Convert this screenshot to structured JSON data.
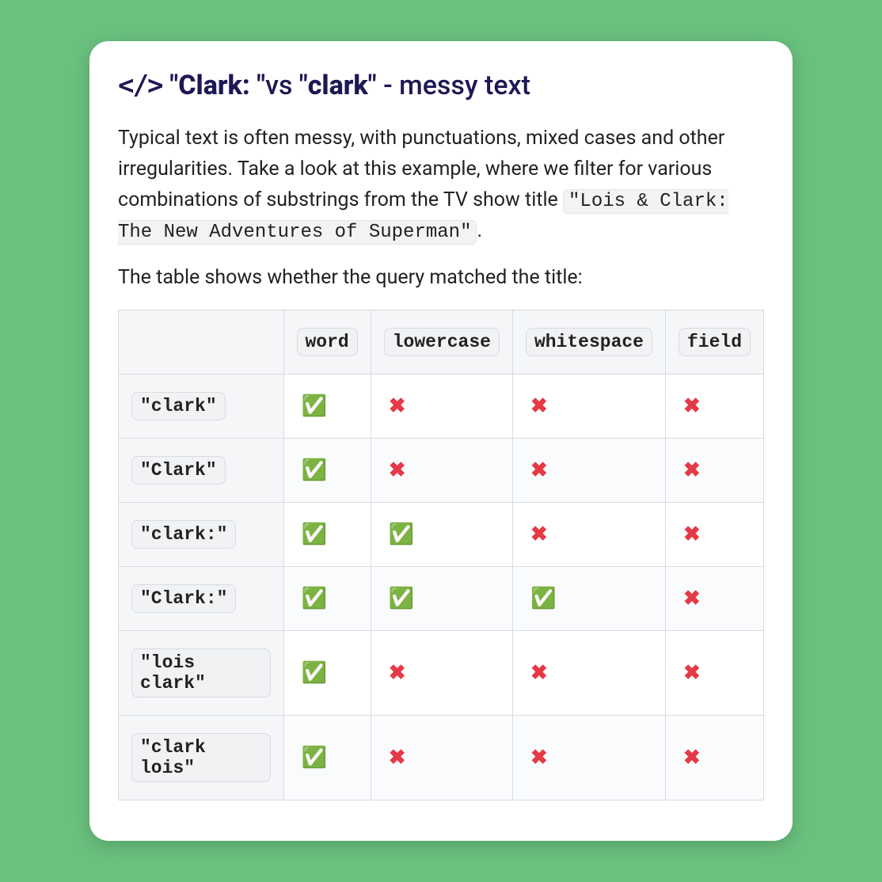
{
  "headline": {
    "icon_label": "</>",
    "part_quote1": "\"",
    "part_clark_bold": "Clark: ",
    "part_quote2": "\"",
    "part_vs": "vs ",
    "part_quote3": "\"",
    "part_clark2": "clark",
    "part_quote4": "\" ",
    "part_dash": "- ",
    "part_messy": "messy text"
  },
  "paragraph": {
    "text_before": "Typical text is often messy, with punctuations, mixed cases and other irregularities. Take a look at this example, where we filter for various combinations of substrings from the TV show title ",
    "code": "\"Lois & Clark: The New Adventures of Superman\"",
    "text_after": "."
  },
  "subhead": "The table shows whether the query matched the title:",
  "table": {
    "columns": [
      "word",
      "lowercase",
      "whitespace",
      "field"
    ],
    "rows": [
      {
        "label": "\"clark\"",
        "values": [
          "yes",
          "no",
          "no",
          "no"
        ]
      },
      {
        "label": "\"Clark\"",
        "values": [
          "yes",
          "no",
          "no",
          "no"
        ]
      },
      {
        "label": "\"clark:\"",
        "values": [
          "yes",
          "yes",
          "no",
          "no"
        ]
      },
      {
        "label": "\"Clark:\"",
        "values": [
          "yes",
          "yes",
          "yes",
          "no"
        ]
      },
      {
        "label": "\"lois clark\"",
        "values": [
          "yes",
          "no",
          "no",
          "no"
        ]
      },
      {
        "label": "\"clark lois\"",
        "values": [
          "yes",
          "no",
          "no",
          "no"
        ]
      }
    ]
  },
  "marks": {
    "yes": "✅",
    "no": "✖"
  }
}
